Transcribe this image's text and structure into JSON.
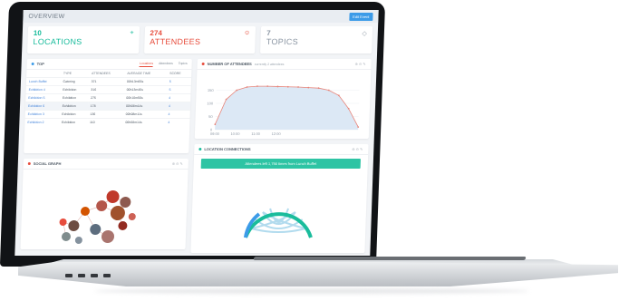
{
  "header": {
    "title": "OVERVIEW",
    "edit_label": "Edit Event"
  },
  "stats": [
    {
      "number": "10",
      "label": "LOCATIONS",
      "color": "#1abc9c",
      "icon": "map-pin-icon"
    },
    {
      "number": "274",
      "label": "ATTENDEES",
      "color": "#e74c3c",
      "icon": "people-icon"
    },
    {
      "number": "7",
      "label": "TOPICS",
      "color": "#8b96a3",
      "icon": "tag-icon"
    }
  ],
  "top_panel": {
    "title": "TOP",
    "tabs": [
      "Locations",
      "Attendees",
      "Topics"
    ],
    "columns": [
      "",
      "TYPE",
      "ATTENDEES",
      "AVERAGE TIME",
      "SCORE"
    ],
    "rows": [
      [
        "Lunch Buffet",
        "Catering",
        "371",
        "00h13m55s",
        "5"
      ],
      [
        "Exhibition 4",
        "Exhibition",
        "316",
        "00h13m45s",
        "5"
      ],
      [
        "Exhibition 5",
        "Exhibition",
        "275",
        "00h10m56s",
        "4"
      ],
      [
        "Exhibition 6",
        "Exhibition",
        "178",
        "00h08m14s",
        "4"
      ],
      [
        "Exhibition 3",
        "Exhibition",
        "136",
        "00h08m11s",
        "4"
      ],
      [
        "Exhibition 2",
        "Exhibition",
        "110",
        "00h08m14s",
        "4"
      ]
    ]
  },
  "attendees_panel": {
    "title": "NUMBER OF ATTENDEES",
    "subtitle": "currently 2 attendees",
    "chart_data": {
      "type": "area",
      "x": [
        "09:00",
        "09:30",
        "10:00",
        "10:30",
        "11:00",
        "11:30",
        "12:00",
        "12:30",
        "13:00",
        "13:30",
        "14:00",
        "14:30",
        "15:00",
        "15:30",
        "16:00"
      ],
      "values": [
        20,
        115,
        150,
        162,
        165,
        165,
        164,
        163,
        162,
        160,
        158,
        150,
        130,
        80,
        10
      ],
      "xticks": [
        "09:00",
        "10:00",
        "11:00",
        "12:00"
      ],
      "yticks": [
        "0",
        "50",
        "100",
        "150"
      ],
      "ylim": [
        0,
        200
      ],
      "color": "#e8857a",
      "fill": "#dce8f5"
    }
  },
  "social_panel": {
    "title": "SOCIAL GRAPH"
  },
  "connections_panel": {
    "title": "LOCATION CONNECTIONS",
    "banner": "Attendees left 1,756 times from Lunch Buffet"
  }
}
